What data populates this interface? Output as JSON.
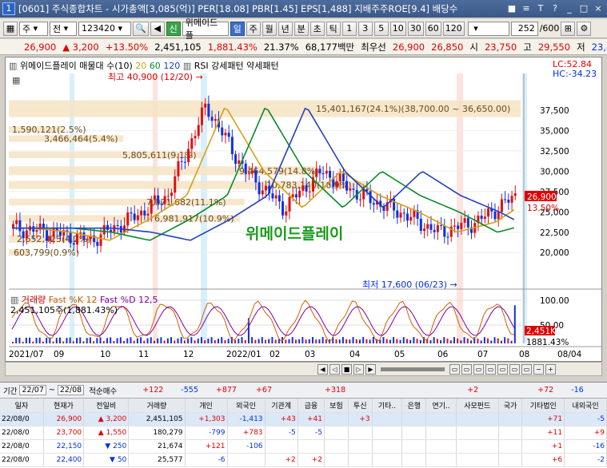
{
  "window": {
    "number": "1",
    "title": "[0601] 주식종합차트 - 시가총액[3,085(억)] PER[18.08] PBR[1.45] EPS[1,488] 지배주주ROE[9.4] 배당수",
    "buttons": [
      "■",
      "≡",
      "T",
      "?",
      "_",
      "□",
      "×"
    ]
  },
  "toolbar": {
    "market": "주",
    "scope": "전",
    "code": "123420",
    "stock_tag": "신",
    "stock_name": "위메이드플",
    "periods": [
      "일",
      "주",
      "월",
      "년",
      "분",
      "초",
      "틱"
    ],
    "active_period": "일",
    "minutes": [
      "1",
      "3",
      "5",
      "10",
      "30",
      "60",
      "120"
    ],
    "count": "252",
    "total": "/600"
  },
  "quote": {
    "price": "26,900",
    "change": "3,200",
    "change_pct": "+13.50%",
    "volume": "2,451,105",
    "volume_pct": "1,881.43%",
    "turnover": "21.37%",
    "amount": "68,177백만",
    "priority_label": "최우선",
    "ask": "26,900",
    "bid": "26,850",
    "open_label": "시",
    "open": "23,750",
    "high_label": "고",
    "high": "29,550",
    "low_label": "저",
    "low": "23,450"
  },
  "chart": {
    "main_title": "위메이드플레이 매물대 수(10)",
    "ma_labels": [
      "20",
      "60",
      "120"
    ],
    "ma_colors": [
      "#d4a017",
      "#0a8a2a",
      "#2040c0"
    ],
    "pattern_labels": [
      "RSI 강세패턴",
      "약세패턴"
    ],
    "lc": "LC:52.84",
    "hc": "HC:-34.23",
    "high_note": "최고 40,900 (12/20)",
    "low_note": "최저 17,600 (06/23)",
    "watermark": "위메이드플레이",
    "current_price_tag": "26,900",
    "current_pct_tag": "13.50%",
    "volume_profile": [
      {
        "label": "15,401,167(24.1%)(38,700.00 ~ 36,650.00)",
        "value": 24.1
      },
      {
        "label": "1,590,121(2.5%)",
        "value": 2.5
      },
      {
        "label": "3,466,464(5.4%)",
        "value": 5.4
      },
      {
        "label": "5,805,611(9.1%)",
        "value": 9.1
      },
      {
        "label": "9,464,579(14.8%)",
        "value": 14.8
      },
      {
        "label": "10,783,140(16.9%)",
        "value": 16.9
      },
      {
        "label": "7,071,682(11.1%)",
        "value": 11.1
      },
      {
        "label": "6,981,917(10.9%)",
        "value": 10.9
      },
      {
        "label": "2,652,423(4.2%)",
        "value": 4.2
      },
      {
        "label": "603,799(0.9%)",
        "value": 0.9
      }
    ],
    "price_ticks": [
      "37,500",
      "35,000",
      "32,500",
      "30,000",
      "27,500",
      "25,000",
      "22,500",
      "20,000"
    ],
    "date_ticks": [
      "2021/07",
      "09",
      "10",
      "11",
      "12",
      "2022/01",
      "02",
      "03",
      "04",
      "05",
      "06",
      "07",
      "08",
      "08/04"
    ],
    "sub_labels": [
      "거래량",
      "Fast %K 12",
      "Fast %D 12,5"
    ],
    "sub_volume": "2,451,105주(1,881.43%)",
    "sub_ticks": [
      "100.00",
      "50.00"
    ],
    "sub_vol_tag": "2,451K",
    "sub_pct_tag": "1881.43%"
  },
  "chart_data": {
    "type": "candlestick",
    "title": "위메이드플레이 매물대 수(10)",
    "ylim": [
      16000,
      42000
    ],
    "x": [
      "2021/07",
      "09",
      "10",
      "11",
      "12",
      "2022/01",
      "02",
      "03",
      "04",
      "05",
      "06",
      "07",
      "08"
    ],
    "close_approx": [
      23000,
      22500,
      21500,
      24000,
      27000,
      38000,
      30000,
      25500,
      30000,
      27000,
      25000,
      22500,
      23750,
      26900
    ],
    "high": 40900,
    "low": 17600
  },
  "bottom": {
    "head": [
      "기간",
      "22/07",
      "~",
      "22/08",
      "적순매수"
    ],
    "head_values": [
      "+122",
      "-555",
      "+877",
      "+67",
      "+318",
      "+2",
      "+72",
      "-16"
    ],
    "columns": [
      "일자",
      "현재가",
      "전일비",
      "거래량",
      "개인",
      "외국인",
      "기관계",
      "금융",
      "보험",
      "투신",
      "기타..",
      "은행",
      "연기..",
      "사모펀드",
      "국가",
      "기타법인",
      "내외국인"
    ],
    "rows": [
      {
        "date": "22/08/0",
        "price": "26,900",
        "dir": "up",
        "diff": "3,200",
        "vol": "2,451,105",
        "p": "+1,303",
        "f": "-1,413",
        "i": "+43",
        "fin": "+41",
        "ins": "",
        "inv": "+3",
        "etc": "",
        "bank": "",
        "pen": "",
        "pe": "",
        "gov": "",
        "corp": "+71",
        "fx": "-5"
      },
      {
        "date": "22/08/0",
        "price": "23,700",
        "dir": "up",
        "diff": "1,550",
        "vol": "180,279",
        "p": "-799",
        "f": "+783",
        "i": "-5",
        "fin": "-5",
        "ins": "",
        "inv": "",
        "etc": "",
        "bank": "",
        "pen": "",
        "pe": "",
        "gov": "",
        "corp": "+11",
        "fx": "+9"
      },
      {
        "date": "22/08/0",
        "price": "22,150",
        "dir": "down",
        "diff": "250",
        "vol": "21,674",
        "p": "+121",
        "f": "-106",
        "i": "",
        "fin": "",
        "ins": "",
        "inv": "",
        "etc": "",
        "bank": "",
        "pen": "",
        "pe": "",
        "gov": "",
        "corp": "+1",
        "fx": "-16"
      },
      {
        "date": "22/08/0",
        "price": "22,400",
        "dir": "down",
        "diff": "50",
        "vol": "25,577",
        "p": "-6",
        "f": "",
        "i": "+2",
        "fin": "+2",
        "ins": "",
        "inv": "",
        "etc": "",
        "bank": "",
        "pen": "",
        "pe": "",
        "gov": "",
        "corp": "+6",
        "fx": "-2"
      }
    ]
  }
}
